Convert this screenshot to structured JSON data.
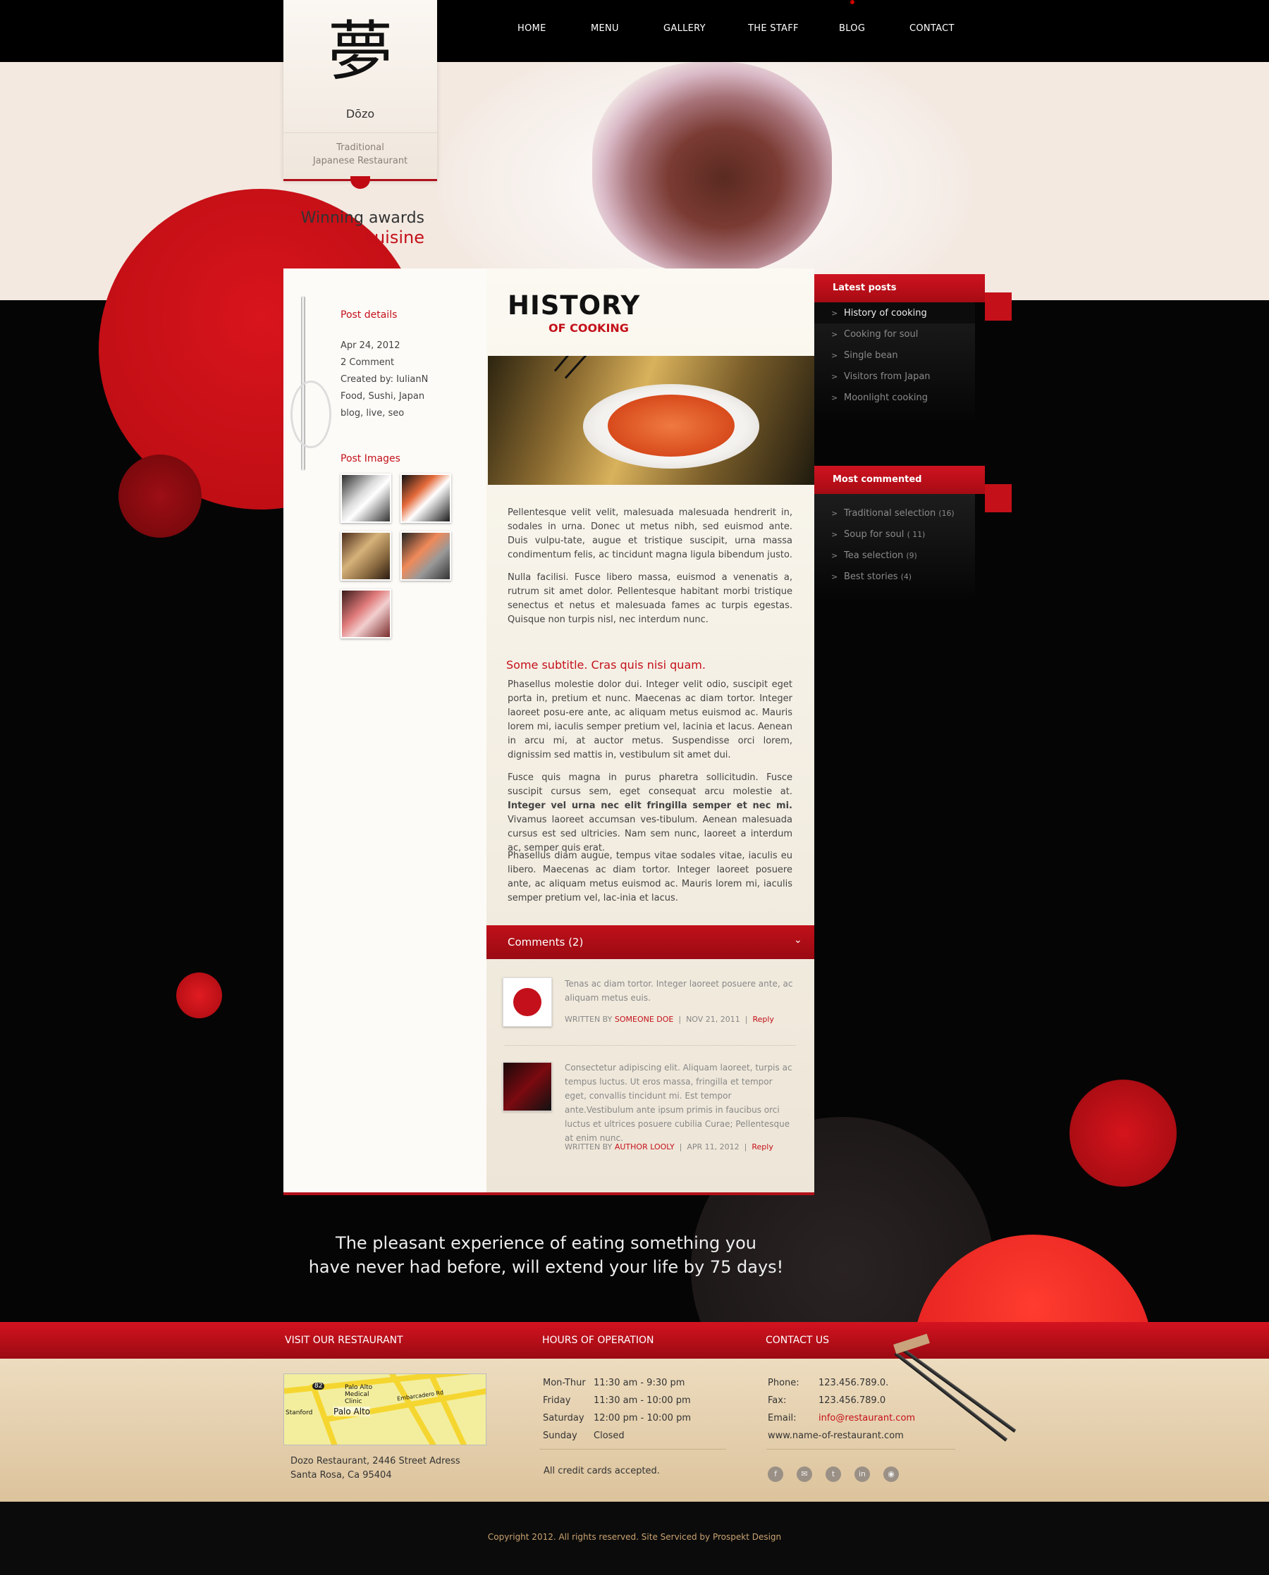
{
  "nav": {
    "items": [
      "HOME",
      "MENU",
      "GALLERY",
      "THE STAFF",
      "BLOG",
      "CONTACT"
    ]
  },
  "logo": {
    "kanji": "夢",
    "name": "Dōzo",
    "tagline1": "Traditional",
    "tagline2": "Japanese Restaurant"
  },
  "hero": {
    "line1": "Winning awards",
    "line2": "cuisine"
  },
  "post": {
    "title": "HISTORY",
    "title_sub": "OF COOKING",
    "details_label": "Post details",
    "date": "Apr 24, 2012",
    "comments": "2 Comment",
    "author": "Created by: IulianN",
    "categories": "Food, Sushi, Japan",
    "tags": "blog, live, seo",
    "images_label": "Post Images",
    "p1": "Pellentesque velit velit, malesuada malesuada hendrerit in, sodales in urna. Donec ut metus nibh, sed euismod ante. Duis vulpu-tate, augue et tristique suscipit, urna massa condimentum felis, ac tincidunt magna ligula bibendum justo.",
    "p2": "Nulla facilisi. Fusce libero massa, euismod a venenatis a, rutrum sit amet dolor. Pellentesque habitant morbi tristique senectus et netus et malesuada fames ac turpis egestas. Quisque non turpis nisl, nec interdum nunc.",
    "subtitle": "Some subtitle. Cras quis nisi quam.",
    "p3": "Phasellus molestie dolor dui. Integer velit odio, suscipit eget porta in, pretium et nunc. Maecenas ac diam tortor. Integer laoreet posu-ere ante, ac aliquam metus euismod ac. Mauris lorem mi, iaculis semper pretium vel, lacinia et lacus. Aenean in arcu mi, at auctor metus. Suspendisse orci lorem, dignissim sed mattis in, vestibulum sit amet dui.",
    "p4a": "Fusce quis magna in purus pharetra sollicitudin. Fusce suscipit cursus sem, eget consequat arcu molestie at.",
    "p4b": "Integer vel urna nec elit fringilla semper et nec mi.",
    "p4c": "Vivamus laoreet accumsan ves-tibulum. Aenean malesuada cursus est sed ultricies. Nam sem nunc, laoreet a interdum ac, semper quis erat.",
    "p5": "Phasellus diam augue, tempus vitae sodales vitae, iaculis eu libero. Maecenas ac diam tortor. Integer laoreet posuere ante, ac aliquam metus euismod ac. Mauris lorem mi, iaculis semper pretium vel, lac-inia et lacus."
  },
  "comments": {
    "header": "Comments (2)",
    "list": [
      {
        "text": "Tenas ac diam tortor. Integer laoreet posuere ante, ac aliquam metus euis.",
        "written_by": "WRITTEN BY",
        "author": "SOMEONE DOE",
        "date": "NOV 21, 2011",
        "reply": "Reply"
      },
      {
        "text": "Consectetur adipiscing elit. Aliquam laoreet, turpis ac tempus luctus. Ut eros massa, fringilla et tempor eget, convallis tincidunt mi. Est tempor ante.Vestibulum ante ipsum primis in faucibus orci luctus et ultrices posuere cubilia Curae; Pellentesque at enim nunc.",
        "written_by": "WRITTEN BY",
        "author": "AUTHOR LOOLY",
        "date": "APR 11, 2012",
        "reply": "Reply"
      }
    ]
  },
  "sidebar": {
    "latest_title": "Latest posts",
    "latest": [
      "History of cooking",
      "Cooking for soul",
      "Single bean",
      "Visitors from Japan",
      "Moonlight cooking"
    ],
    "most_title": "Most commented",
    "most": [
      {
        "label": "Traditional selection",
        "count": "(16)"
      },
      {
        "label": "Soup for soul",
        "count": "( 11)"
      },
      {
        "label": "Tea selection",
        "count": "(9)"
      },
      {
        "label": "Best stories",
        "count": "(4)"
      }
    ]
  },
  "quote": {
    "line1": "The pleasant experience of eating something you",
    "line2": "have never had before, will extend your life by 75 days!"
  },
  "footer": {
    "visit_title": "VISIT OUR RESTAURANT",
    "hours_title": "HOURS OF OPERATION",
    "contact_title": "CONTACT US",
    "map_labels": [
      "Palo Alto",
      "Palo Alto Medical Clinic",
      "Stanford",
      "Embarcadero Rd",
      "82"
    ],
    "address1": "Dozo Restaurant, 2446 Street Adress",
    "address2": "Santa Rosa, Ca 95404",
    "hours": [
      {
        "day": "Mon-Thur",
        "time": "11:30 am -  9:30 pm"
      },
      {
        "day": "Friday",
        "time": "11:30 am - 10:00 pm"
      },
      {
        "day": "Saturday",
        "time": "12:00 pm - 10:00 pm"
      },
      {
        "day": "Sunday",
        "time": "Closed"
      }
    ],
    "cards": "All credit cards accepted.",
    "phone_label": "Phone:",
    "phone": "123.456.789.0.",
    "fax_label": "Fax:",
    "fax": "123.456.789.0",
    "email_label": "Email:",
    "email": "info@restaurant.com",
    "website": "www.name-of-restaurant.com",
    "copyright": "Copyright 2012. All rights reserved. Site Serviced by Prospekt Design"
  },
  "colors": {
    "accent": "#c4101a",
    "dark": "#050505",
    "cream": "#f3e9e1"
  }
}
